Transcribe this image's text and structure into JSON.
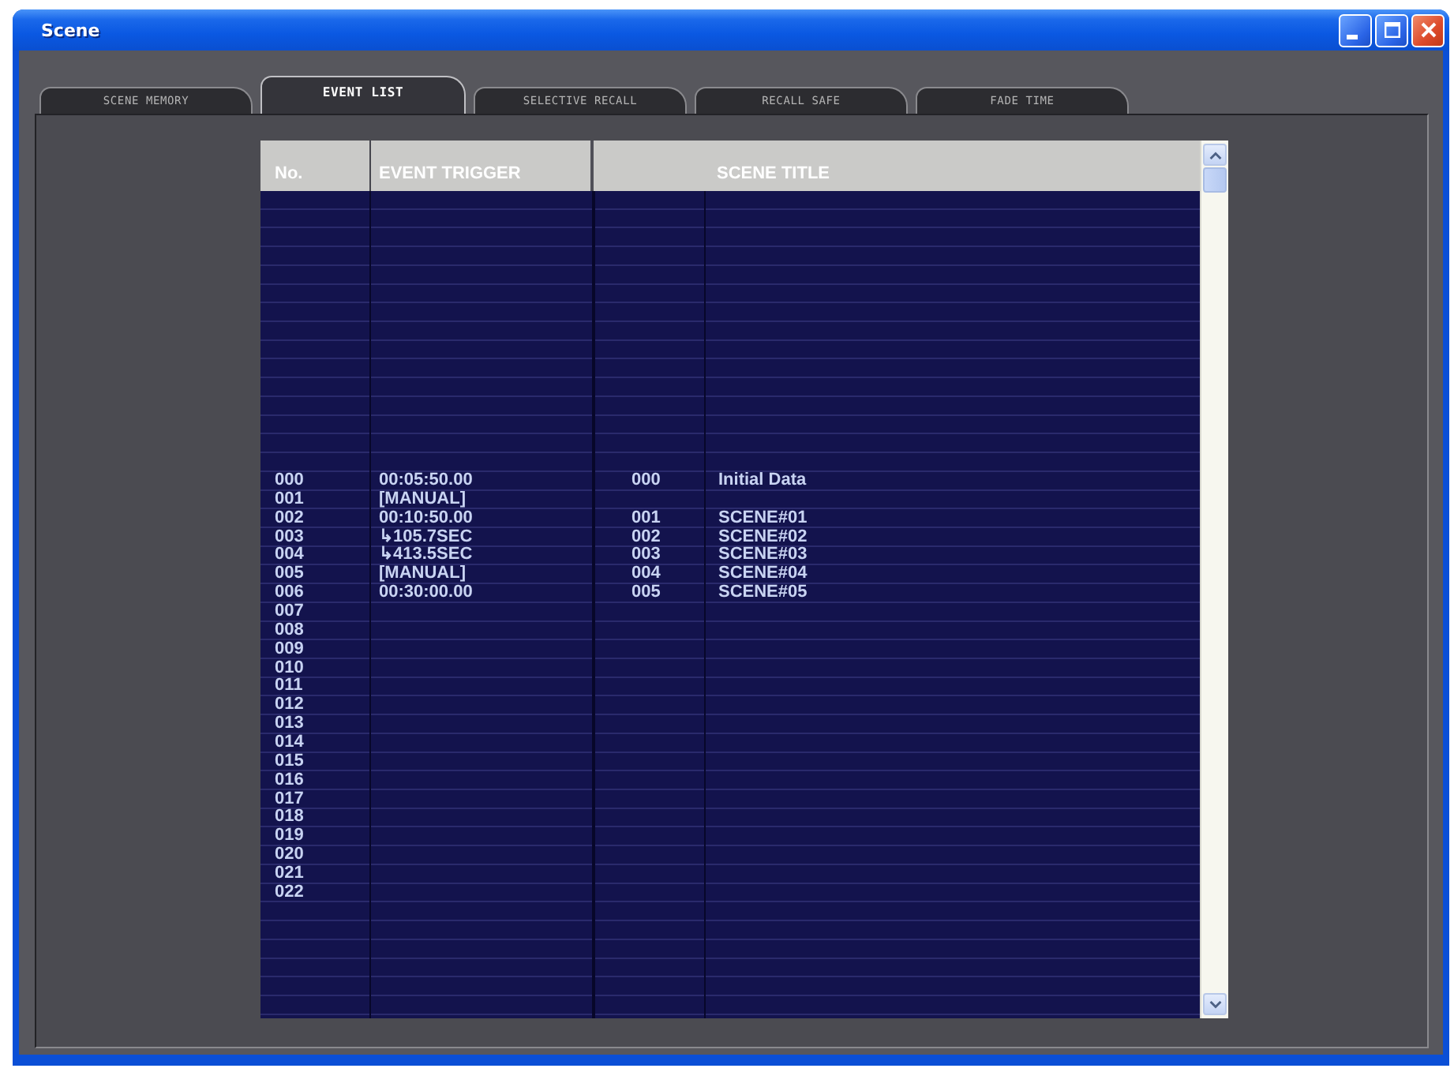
{
  "window": {
    "title": "Scene"
  },
  "tabs": [
    {
      "label": "SCENE MEMORY",
      "selected": false
    },
    {
      "label": "EVENT LIST",
      "selected": true
    },
    {
      "label": "SELECTIVE RECALL",
      "selected": false
    },
    {
      "label": "RECALL SAFE",
      "selected": false
    },
    {
      "label": "FADE TIME",
      "selected": false
    }
  ],
  "table": {
    "columns": [
      "No.",
      "EVENT TRIGGER",
      "SCENE TITLE"
    ],
    "rows": [
      {
        "no": "000",
        "trigger": "00:05:50.00",
        "scene_no": "000",
        "scene_title": "Initial Data"
      },
      {
        "no": "001",
        "trigger": "[MANUAL]"
      },
      {
        "no": "002",
        "trigger": "00:10:50.00",
        "scene_no": "001",
        "scene_title": "SCENE#01"
      },
      {
        "no": "003",
        "trigger": "↳105.7SEC",
        "scene_no": "002",
        "scene_title": "SCENE#02"
      },
      {
        "no": "004",
        "trigger": "↳413.5SEC",
        "scene_no": "003",
        "scene_title": "SCENE#03"
      },
      {
        "no": "005",
        "trigger": "[MANUAL]",
        "scene_no": "004",
        "scene_title": "SCENE#04"
      },
      {
        "no": "006",
        "trigger": "00:30:00.00",
        "scene_no": "005",
        "scene_title": "SCENE#05"
      },
      {
        "no": "007"
      },
      {
        "no": "008"
      },
      {
        "no": "009"
      },
      {
        "no": "010"
      },
      {
        "no": "011"
      },
      {
        "no": "012"
      },
      {
        "no": "013"
      },
      {
        "no": "014"
      },
      {
        "no": "015"
      },
      {
        "no": "016"
      },
      {
        "no": "017"
      },
      {
        "no": "018"
      },
      {
        "no": "019"
      },
      {
        "no": "020"
      },
      {
        "no": "021"
      },
      {
        "no": "022"
      }
    ]
  }
}
